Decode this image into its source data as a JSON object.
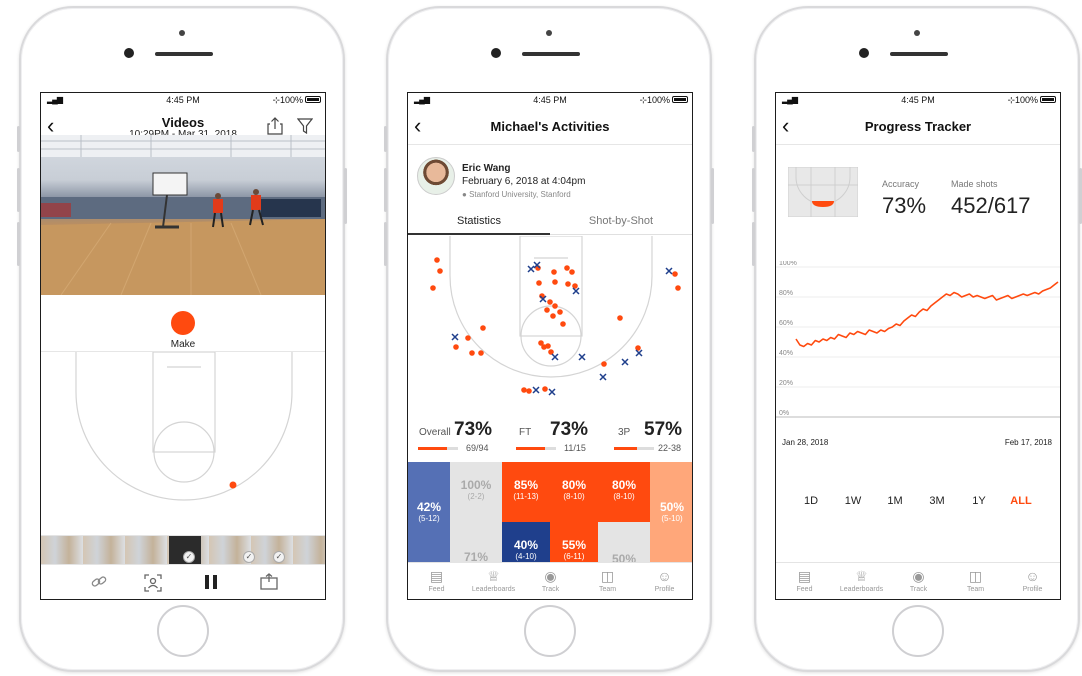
{
  "colors": {
    "accent": "#ff4a0f",
    "navy": "#1f3f8c",
    "light_orange": "#ffa77a",
    "gray": "#d9d9d9",
    "blue_mid": "#5570b5"
  },
  "status": {
    "signal": "▂▄▆",
    "wifi": "ᯤ",
    "time": "4:45 PM",
    "battery": "⊹100%"
  },
  "phone1": {
    "nav": {
      "title": "Videos",
      "subtitle": "10:29PM - Mar 31, 2018"
    },
    "make_label": "Make",
    "icons": [
      "share-icon",
      "filter-icon",
      "link-icon",
      "focus-icon",
      "pause-icon",
      "export-icon"
    ]
  },
  "phone2": {
    "nav": {
      "title": "Michael's Activities"
    },
    "profile": {
      "name": "Eric Wang",
      "date": "February 6, 2018 at 4:04pm",
      "location": "Stanford University, Stanford"
    },
    "tabs": [
      "Statistics",
      "Shot-by-Shot"
    ],
    "stats": [
      {
        "label": "Overall",
        "value": "73%",
        "frac": "69/94",
        "fill": 0.73
      },
      {
        "label": "FT",
        "value": "73%",
        "frac": "11/15",
        "fill": 0.73
      },
      {
        "label": "3P",
        "value": "57%",
        "frac": "22-38",
        "fill": 0.57
      }
    ],
    "zones": [
      {
        "pct": "42%",
        "frac": "(5-12)",
        "style": "blue_mid"
      },
      {
        "pct": "100%",
        "frac": "(2-2)",
        "style": "gray"
      },
      {
        "pct": "85%",
        "frac": "(11-13)",
        "style": "accent"
      },
      {
        "pct": "80%",
        "frac": "(8-10)",
        "style": "accent"
      },
      {
        "pct": "80%",
        "frac": "(8-10)",
        "style": "accent"
      },
      {
        "pct": "50%",
        "frac": "(5-10)",
        "style": "light_orange"
      },
      {
        "pct": "71%",
        "frac": "",
        "style": "gray"
      },
      {
        "pct": "40%",
        "frac": "(4-10)",
        "style": "navy"
      },
      {
        "pct": "55%",
        "frac": "(6-11)",
        "style": "accent"
      },
      {
        "pct": "50%",
        "frac": "",
        "style": "gray"
      }
    ]
  },
  "tabbar": [
    {
      "label": "Feed",
      "icon": "feed-icon"
    },
    {
      "label": "Leaderboards",
      "icon": "crown-icon"
    },
    {
      "label": "Track",
      "icon": "track-icon"
    },
    {
      "label": "Team",
      "icon": "jersey-icon"
    },
    {
      "label": "Profile",
      "icon": "profile-icon"
    }
  ],
  "phone3": {
    "nav": {
      "title": "Progress Tracker"
    },
    "accuracy_label": "Accuracy",
    "accuracy_value": "73%",
    "made_label": "Made shots",
    "made_value": "452/617",
    "date_start": "Jan 28, 2018",
    "date_end": "Feb 17, 2018",
    "ranges": [
      "1D",
      "1W",
      "1M",
      "3M",
      "1Y",
      "ALL"
    ],
    "active_range": "ALL"
  },
  "chart_data": {
    "type": "line",
    "title": "",
    "xlabel": "",
    "ylabel": "",
    "ylim": [
      0,
      100
    ],
    "yticks": [
      "100%",
      "80%",
      "60%",
      "40%",
      "20%",
      "0%"
    ],
    "x_range": [
      "Jan 28, 2018",
      "Feb 17, 2018"
    ],
    "grid": true,
    "series": [
      {
        "values": [
          52,
          48,
          47,
          49,
          48,
          51,
          50,
          52,
          51,
          53,
          52,
          55,
          54,
          53,
          56,
          55,
          57,
          56,
          55,
          58,
          57,
          56,
          58,
          57,
          59,
          60,
          62,
          61,
          64,
          66,
          68,
          67,
          70,
          72,
          71,
          74,
          76,
          78,
          80,
          82,
          81,
          83,
          82,
          80,
          81,
          82,
          80,
          81,
          80,
          79,
          80,
          81,
          78,
          79,
          80,
          81,
          79,
          80,
          81,
          82,
          81,
          82,
          83,
          82,
          84,
          85,
          86,
          88,
          90
        ]
      }
    ]
  }
}
